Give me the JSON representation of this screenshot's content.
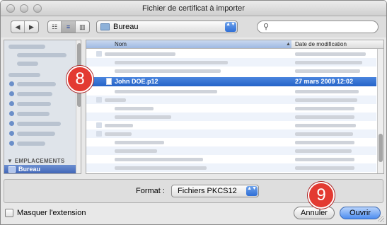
{
  "window": {
    "title": "Fichier de certificat à importer"
  },
  "toolbar": {
    "nav_back": "◀",
    "nav_forward": "▶",
    "view_icon": "☷",
    "view_list": "≡",
    "view_columns": "▥",
    "location": "Bureau",
    "location_arrows": "▲▼",
    "search_icon": "⚲"
  },
  "sidebar": {
    "section_places": "▼ EMPLACEMENTS",
    "selected_item": "Bureau"
  },
  "file_list": {
    "col_name": "Nom",
    "col_date": "Date de modification",
    "sort_indicator": "▲",
    "selected_file": {
      "name": "John DOE.p12",
      "date": "27 mars 2009 12:02"
    }
  },
  "format": {
    "label": "Format :",
    "value": "Fichiers PKCS12",
    "arrows": "▲▼"
  },
  "options": {
    "hide_extension": "Masquer l'extension"
  },
  "buttons": {
    "cancel": "Annuler",
    "open": "Ouvrir"
  },
  "markers": {
    "step8": "8",
    "step9": "9"
  },
  "colors": {
    "selection": "#2563c8",
    "marker": "#e33a32",
    "default_button": "#4d8df0"
  }
}
